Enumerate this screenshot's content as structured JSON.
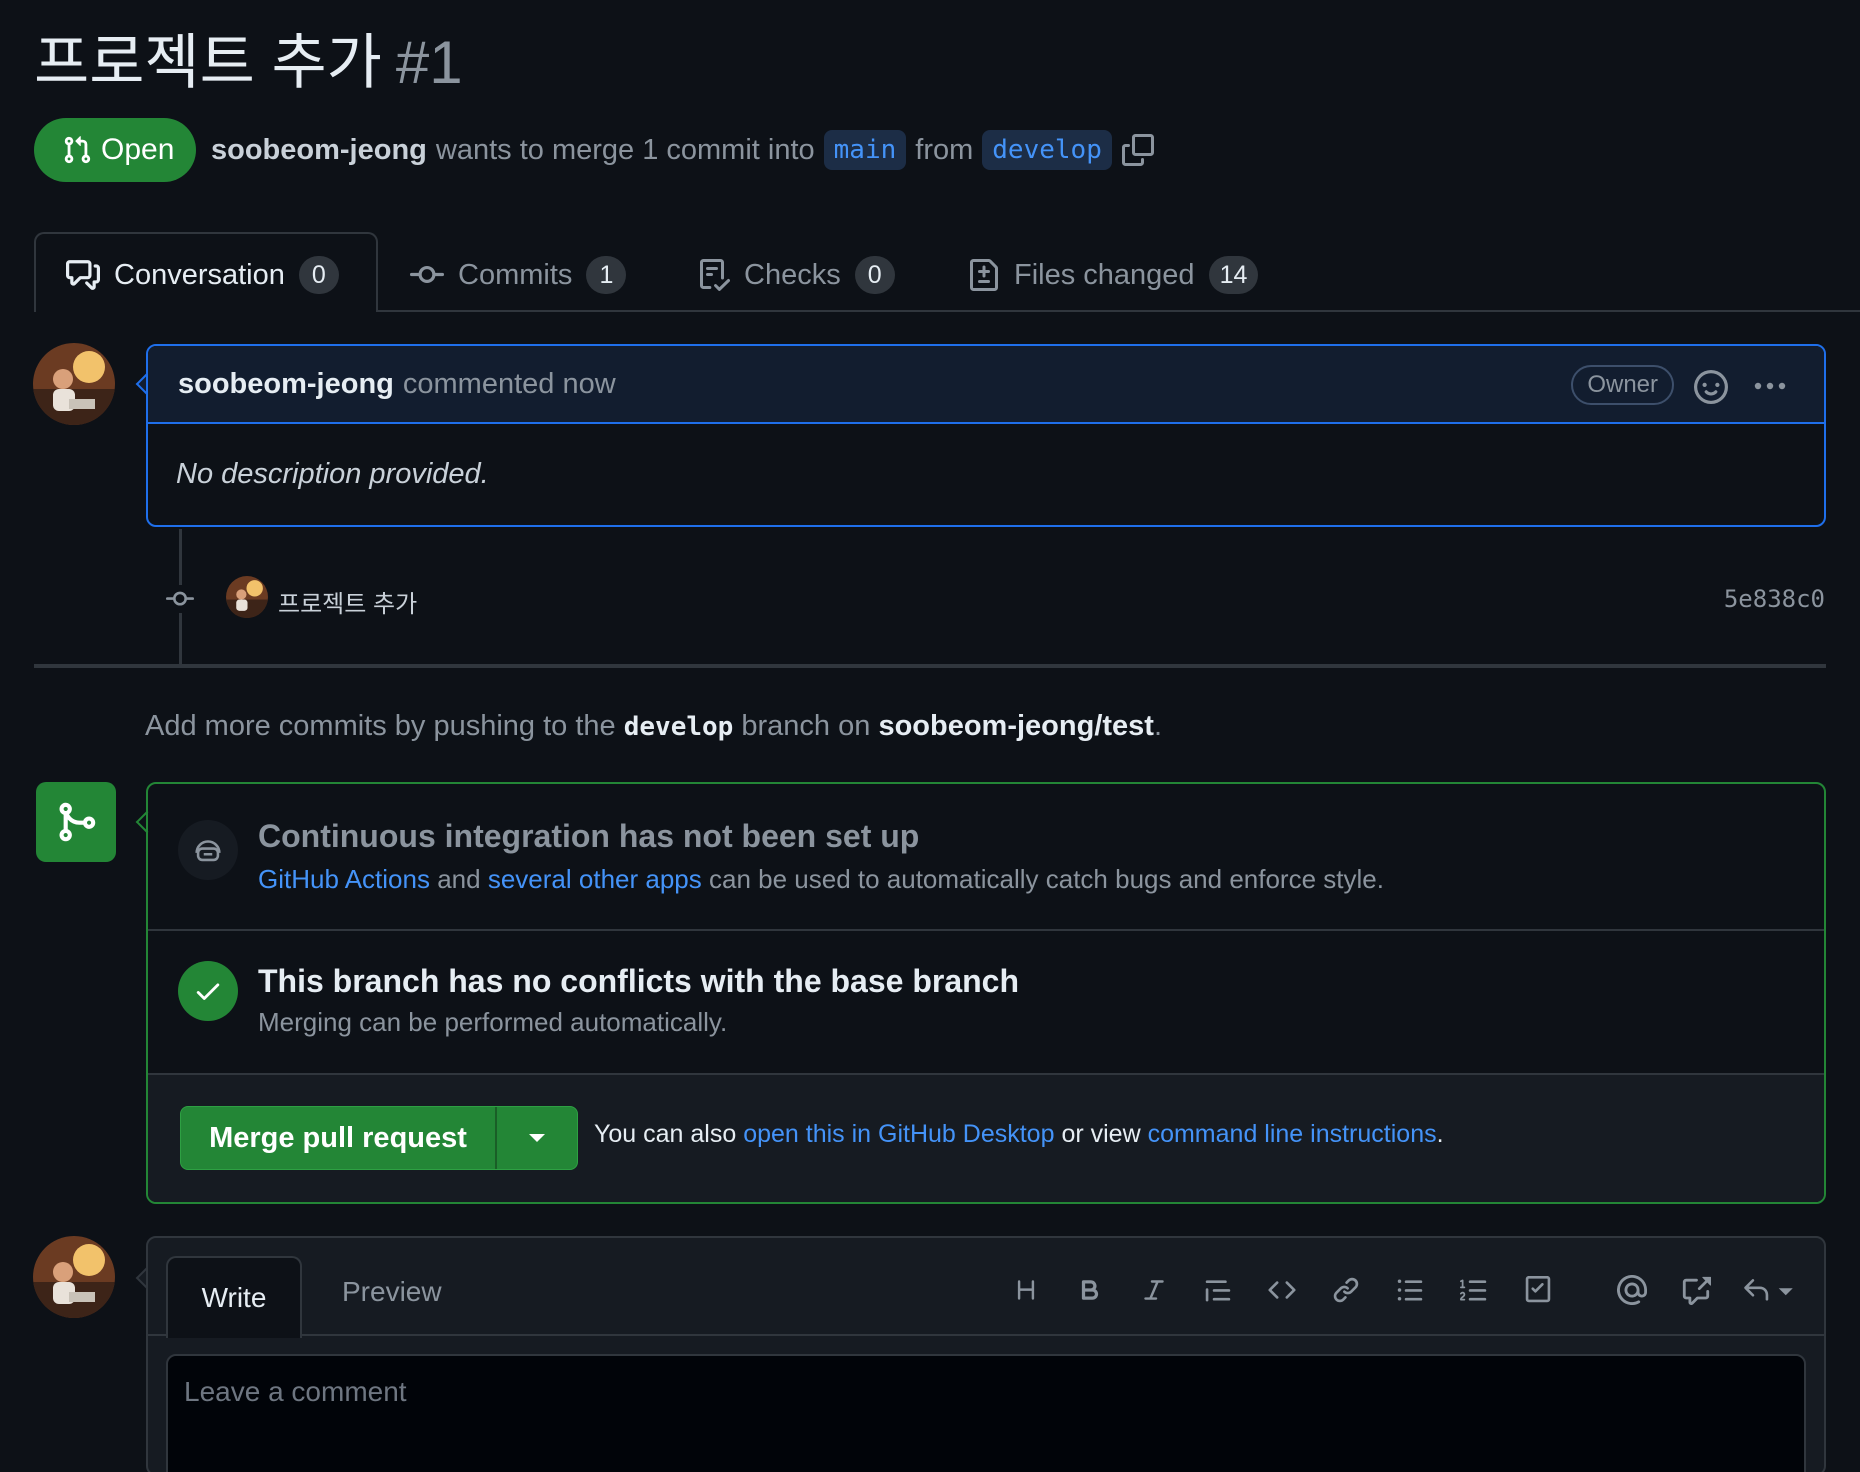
{
  "pr": {
    "title": "프로젝트 추가",
    "number": "#1",
    "status": "Open",
    "author": "soobeom-jeong",
    "merge_text": "wants to merge 1 commit into",
    "base_branch": "main",
    "from_text": "from",
    "head_branch": "develop"
  },
  "tabs": [
    {
      "label": "Conversation",
      "count": "0"
    },
    {
      "label": "Commits",
      "count": "1"
    },
    {
      "label": "Checks",
      "count": "0"
    },
    {
      "label": "Files changed",
      "count": "14"
    }
  ],
  "comment": {
    "author": "soobeom-jeong",
    "action": "commented now",
    "badge": "Owner",
    "body": "No description provided."
  },
  "commit": {
    "message": "프로젝트  추가",
    "sha": "5e838c0"
  },
  "push_hint": {
    "prefix": "Add more commits by pushing to the",
    "branch": "develop",
    "middle": "branch on",
    "repo": "soobeom-jeong/test",
    "suffix": "."
  },
  "merge_box": {
    "ci_title": "Continuous integration has not been set up",
    "ci_link1": "GitHub Actions",
    "ci_and": "and",
    "ci_link2": "several other apps",
    "ci_rest": "can be used to automatically catch bugs and enforce style.",
    "conflict_title": "This branch has no conflicts with the base branch",
    "conflict_sub": "Merging can be performed automatically.",
    "merge_button": "Merge pull request",
    "hint_prefix": "You can also",
    "hint_link1": "open this in GitHub Desktop",
    "hint_mid": "or view",
    "hint_link2": "command line instructions",
    "hint_suffix": "."
  },
  "composer": {
    "write_tab": "Write",
    "preview_tab": "Preview",
    "placeholder": "Leave a comment",
    "toolbar": [
      "heading-icon",
      "bold-icon",
      "italic-icon",
      "quote-icon",
      "code-icon",
      "link-icon",
      "bulleted-list-icon",
      "numbered-list-icon",
      "task-list-icon",
      "mention-icon",
      "cross-reference-icon",
      "saved-replies-icon"
    ]
  },
  "colors": {
    "background": "#0d1117",
    "green": "#238636",
    "blue_link": "#4493f8",
    "comment_border": "#1f6feb",
    "muted": "#8b949e"
  }
}
